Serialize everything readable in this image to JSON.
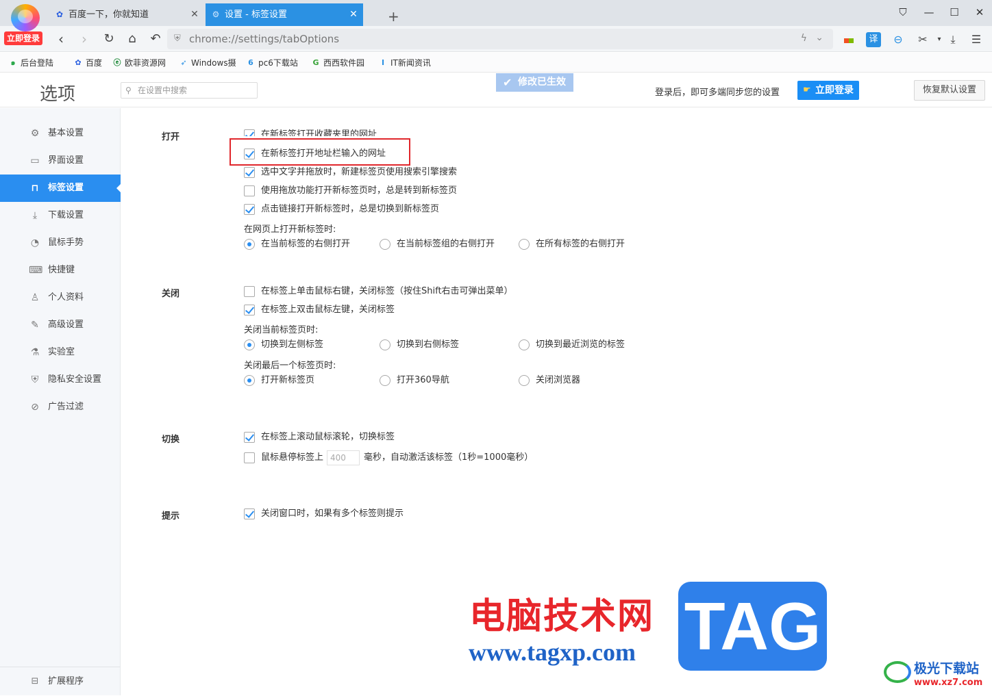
{
  "browser": {
    "login_badge": "立即登录",
    "tabs": [
      {
        "title": "百度一下，你就知道",
        "icon": "baidu-paw-icon"
      },
      {
        "title": "设置 - 标签设置",
        "icon": "gear-icon",
        "active": true
      }
    ],
    "address": "chrome://settings/tabOptions",
    "accent": "#2b91e3"
  },
  "bookmarks": [
    {
      "label": "后台登陆",
      "icon": "swirl-icon"
    },
    {
      "label": "百度",
      "icon": "baidu-paw-icon"
    },
    {
      "label": "欧菲资源网",
      "icon": "circle-e-icon"
    },
    {
      "label": "Windows摄",
      "icon": "bird-icon"
    },
    {
      "label": "pc6下载站",
      "icon": "pc6-icon"
    },
    {
      "label": "西西软件园",
      "icon": "g-leaf-icon"
    },
    {
      "label": "IT新闻资讯",
      "icon": "it-icon"
    }
  ],
  "header": {
    "title": "选项",
    "search_placeholder": "在设置中搜索",
    "toast": "修改已生效",
    "sync_text": "登录后，即可多端同步您的设置",
    "login_button": "立即登录",
    "restore_button": "恢复默认设置"
  },
  "sidebar": {
    "items": [
      {
        "label": "基本设置",
        "icon": "gear-icon"
      },
      {
        "label": "界面设置",
        "icon": "window-icon"
      },
      {
        "label": "标签设置",
        "icon": "tab-icon",
        "active": true
      },
      {
        "label": "下载设置",
        "icon": "download-icon"
      },
      {
        "label": "鼠标手势",
        "icon": "mouse-icon"
      },
      {
        "label": "快捷键",
        "icon": "keyboard-icon"
      },
      {
        "label": "个人资料",
        "icon": "person-icon"
      },
      {
        "label": "高级设置",
        "icon": "wrench-icon"
      },
      {
        "label": "实验室",
        "icon": "flask-icon"
      },
      {
        "label": "隐私安全设置",
        "icon": "shield-icon"
      },
      {
        "label": "广告过滤",
        "icon": "block-icon"
      }
    ],
    "extensions": "扩展程序"
  },
  "content": {
    "open": {
      "title": "打开",
      "options": [
        {
          "label": "在新标签打开收藏夹里的网址",
          "checked": true
        },
        {
          "label": "在新标签打开地址栏输入的网址",
          "checked": true
        },
        {
          "label": "选中文字并拖放时，新建标签页使用搜索引擎搜索",
          "checked": true
        },
        {
          "label": "使用拖放功能打开新标签页时，总是转到新标签页",
          "checked": false
        },
        {
          "label": "点击链接打开新标签时，总是切换到新标签页",
          "checked": true
        }
      ],
      "position_label": "在网页上打开新标签时:",
      "position_options": [
        {
          "label": "在当前标签的右侧打开",
          "selected": true
        },
        {
          "label": "在当前标签组的右侧打开",
          "selected": false
        },
        {
          "label": "在所有标签的右侧打开",
          "selected": false
        }
      ]
    },
    "close": {
      "title": "关闭",
      "options": [
        {
          "label": "在标签上单击鼠标右键，关闭标签（按住Shift右击可弹出菜单）",
          "checked": false
        },
        {
          "label": "在标签上双击鼠标左键，关闭标签",
          "checked": true
        }
      ],
      "current_label": "关闭当前标签页时:",
      "current_options": [
        {
          "label": "切换到左侧标签",
          "selected": true
        },
        {
          "label": "切换到右侧标签",
          "selected": false
        },
        {
          "label": "切换到最近浏览的标签",
          "selected": false
        }
      ],
      "last_label": "关闭最后一个标签页时:",
      "last_options": [
        {
          "label": "打开新标签页",
          "selected": true
        },
        {
          "label": "打开360导航",
          "selected": false
        },
        {
          "label": "关闭浏览器",
          "selected": false
        }
      ]
    },
    "switch": {
      "title": "切换",
      "wheel": {
        "label": "在标签上滚动鼠标滚轮，切换标签",
        "checked": true
      },
      "hover": {
        "prefix": "鼠标悬停标签上",
        "placeholder": "400",
        "suffix": "毫秒，自动激活该标签（1秒=1000毫秒）",
        "checked": false
      }
    },
    "hint": {
      "title": "提示",
      "option": {
        "label": "关闭窗口时，如果有多个标签则提示",
        "checked": true
      }
    }
  },
  "watermark": {
    "cn": "电脑技术网",
    "url": "www.tagxp.com",
    "tag": "TAG",
    "corner": "极光下载站",
    "corner_url": "www.xz7.com"
  }
}
